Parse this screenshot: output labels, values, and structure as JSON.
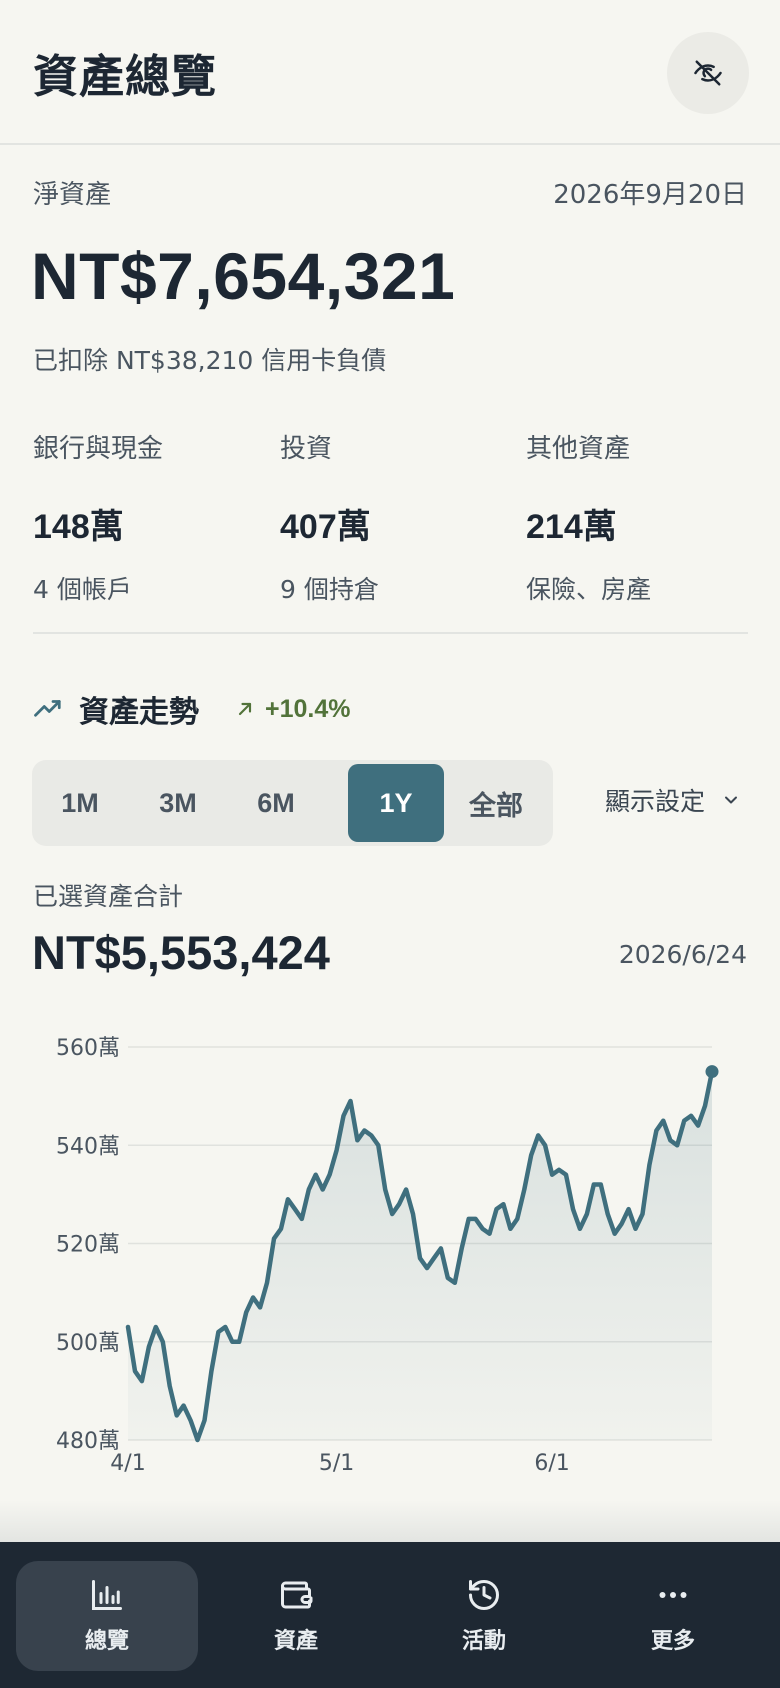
{
  "header": {
    "title": "資產總覽",
    "privacy_icon": "eye-off-icon"
  },
  "net_worth": {
    "label": "淨資產",
    "date": "2026年9月20日",
    "amount": "NT$7,654,321",
    "note": "已扣除 NT$38,210 信用卡負債"
  },
  "categories": [
    {
      "title": "銀行與現金",
      "value": "148萬",
      "sub": "4 個帳戶"
    },
    {
      "title": "投資",
      "value": "407萬",
      "sub": "9 個持倉"
    },
    {
      "title": "其他資產",
      "value": "214萬",
      "sub": "保險、房產"
    }
  ],
  "trend": {
    "icon": "trending-up-icon",
    "title": "資產走勢",
    "change_icon": "arrow-up-right-icon",
    "change": "+10.4%",
    "ranges": [
      "1M",
      "3M",
      "6M",
      "1Y",
      "全部"
    ],
    "active_range": "1Y",
    "display_settings": "顯示設定",
    "selected_label": "已選資產合計",
    "selected_amount": "NT$5,553,424",
    "selected_date": "2026/6/24"
  },
  "colors": {
    "accent": "#3f6f7e",
    "positive": "#52733a",
    "background": "#f6f6f1",
    "tabbar": "#1e2833"
  },
  "chart_data": {
    "type": "area",
    "x_start": "2026-04-01",
    "x_end": "2026-06-24",
    "y_unit": "萬",
    "ylim": [
      480,
      560
    ],
    "yticks": [
      "480萬",
      "500萬",
      "520萬",
      "540萬",
      "560萬"
    ],
    "xticks": [
      "4/1",
      "5/1",
      "6/1"
    ],
    "grid": true,
    "series": [
      {
        "values": [
          503,
          494,
          492,
          499,
          503,
          500,
          491,
          485,
          487,
          484,
          480,
          484,
          494,
          502,
          503,
          500,
          500,
          506,
          509,
          507,
          512,
          521,
          523,
          529,
          527,
          525,
          531,
          534,
          531,
          534,
          539,
          546,
          549,
          541,
          543,
          542,
          540,
          531,
          526,
          528,
          531,
          526,
          517,
          515,
          517,
          519,
          513,
          512,
          519,
          525,
          525,
          523,
          522,
          527,
          528,
          523,
          525,
          531,
          538,
          542,
          540,
          534,
          535,
          534,
          527,
          523,
          526,
          532,
          532,
          526,
          522,
          524,
          527,
          523,
          526,
          536,
          543,
          545,
          541,
          540,
          545,
          546,
          544,
          548,
          555
        ]
      }
    ]
  },
  "tabbar": {
    "items": [
      {
        "label": "總覽",
        "icon": "bar-chart-icon",
        "active": true
      },
      {
        "label": "資產",
        "icon": "wallet-icon",
        "active": false
      },
      {
        "label": "活動",
        "icon": "history-icon",
        "active": false
      },
      {
        "label": "更多",
        "icon": "more-icon",
        "active": false
      }
    ]
  }
}
